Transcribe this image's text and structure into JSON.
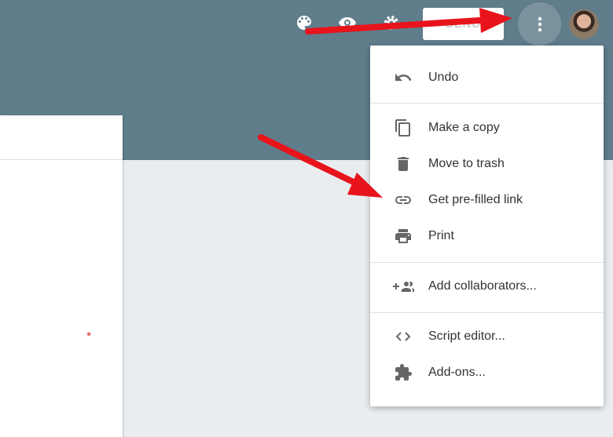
{
  "toolbar": {
    "send_label": "SEND",
    "icons": [
      "palette-icon",
      "eye-icon",
      "gear-icon",
      "more-vert-icon"
    ]
  },
  "menu": {
    "items": [
      {
        "label": "Undo",
        "icon": "undo-icon"
      },
      {
        "label": "Make a copy",
        "icon": "copy-icon"
      },
      {
        "label": "Move to trash",
        "icon": "trash-icon"
      },
      {
        "label": "Get pre-filled link",
        "icon": "link-icon"
      },
      {
        "label": "Print",
        "icon": "print-icon"
      },
      {
        "label": "Add collaborators...",
        "icon": "add-people-icon"
      },
      {
        "label": "Script editor...",
        "icon": "code-icon"
      },
      {
        "label": "Add-ons...",
        "icon": "puzzle-icon"
      }
    ]
  },
  "form": {
    "required_marker": "*"
  },
  "colors": {
    "header": "#607d8b",
    "annotation_arrow": "#e8141b"
  }
}
